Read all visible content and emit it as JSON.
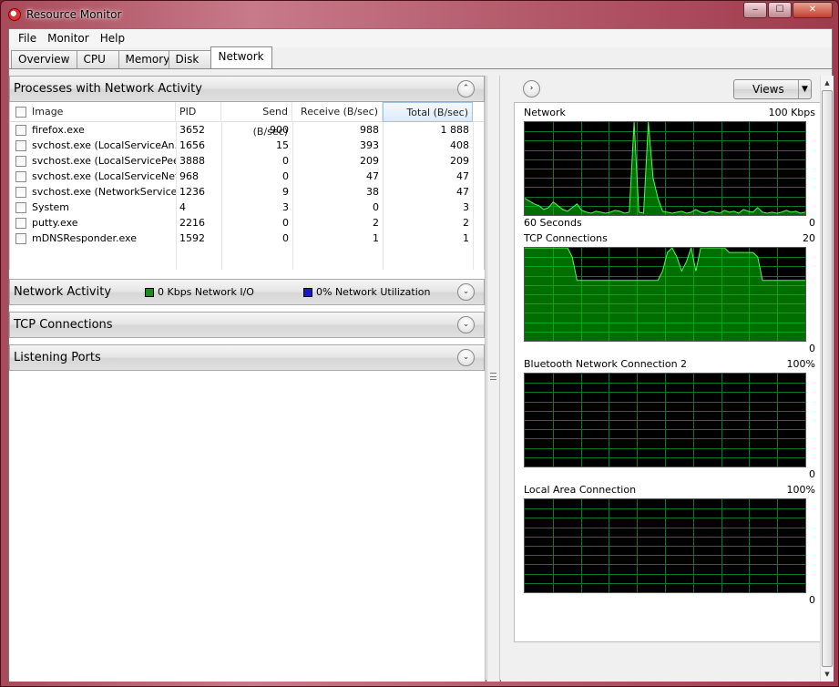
{
  "window": {
    "title": "Resource Monitor",
    "buttons": {
      "minimize": "‒",
      "maximize": "☐",
      "close": "✕"
    }
  },
  "menu": [
    "File",
    "Monitor",
    "Help"
  ],
  "tabs": [
    {
      "label": "Overview",
      "active": false
    },
    {
      "label": "CPU",
      "active": false
    },
    {
      "label": "Memory",
      "active": false
    },
    {
      "label": "Disk",
      "active": false
    },
    {
      "label": "Network",
      "active": true
    }
  ],
  "processes": {
    "title": "Processes with Network Activity",
    "columns": [
      "Image",
      "PID",
      "Send (B/sec)",
      "Receive (B/sec)",
      "Total (B/sec)"
    ],
    "rows": [
      {
        "image": "firefox.exe",
        "pid": "3652",
        "send": "900",
        "receive": "988",
        "total": "1 888"
      },
      {
        "image": "svchost.exe (LocalServiceAn...",
        "pid": "1656",
        "send": "15",
        "receive": "393",
        "total": "408"
      },
      {
        "image": "svchost.exe (LocalServicePee...",
        "pid": "3888",
        "send": "0",
        "receive": "209",
        "total": "209"
      },
      {
        "image": "svchost.exe (LocalServiceNet...",
        "pid": "968",
        "send": "0",
        "receive": "47",
        "total": "47"
      },
      {
        "image": "svchost.exe (NetworkService)",
        "pid": "1236",
        "send": "9",
        "receive": "38",
        "total": "47"
      },
      {
        "image": "System",
        "pid": "4",
        "send": "3",
        "receive": "0",
        "total": "3"
      },
      {
        "image": "putty.exe",
        "pid": "2216",
        "send": "0",
        "receive": "2",
        "total": "2"
      },
      {
        "image": "mDNSResponder.exe",
        "pid": "1592",
        "send": "0",
        "receive": "1",
        "total": "1"
      }
    ]
  },
  "network_activity": {
    "title": "Network Activity",
    "io_label": "0 Kbps Network I/O",
    "util_label": "0% Network Utilization",
    "io_color": "#1e8a1e",
    "util_color": "#1a1ab8"
  },
  "tcp_section": {
    "title": "TCP Connections"
  },
  "listening_section": {
    "title": "Listening Ports"
  },
  "views_button": "Views",
  "graphs": [
    {
      "title": "Network",
      "max": "100 Kbps",
      "min": "0",
      "footer": "60 Seconds",
      "chart_data": {
        "type": "area",
        "ylim": [
          0,
          100
        ],
        "values": [
          18,
          15,
          12,
          10,
          6,
          8,
          14,
          10,
          6,
          4,
          8,
          12,
          5,
          3,
          2,
          4,
          3,
          2,
          3,
          5,
          4,
          2,
          3,
          100,
          3,
          2,
          100,
          40,
          18,
          4,
          3,
          2,
          3,
          4,
          2,
          3,
          6,
          3,
          2,
          4,
          3,
          2,
          5,
          3,
          4,
          2,
          6,
          4,
          3,
          8,
          3,
          2,
          3,
          2,
          3,
          5,
          3,
          4,
          2,
          3
        ]
      }
    },
    {
      "title": "TCP Connections",
      "max": "20",
      "min": "0",
      "chart_data": {
        "type": "area",
        "ylim": [
          0,
          20
        ],
        "values": [
          20,
          20,
          20,
          20,
          20,
          20,
          20,
          20,
          20,
          20,
          18,
          13,
          13,
          13,
          13,
          13,
          13,
          13,
          13,
          13,
          13,
          13,
          13,
          13,
          13,
          13,
          13,
          13,
          13,
          15,
          19,
          20,
          18,
          15,
          17,
          20,
          15,
          20,
          20,
          20,
          20,
          20,
          20,
          19,
          19,
          19,
          19,
          19,
          19,
          18,
          13,
          13,
          13,
          13,
          13,
          13,
          13,
          13,
          13,
          13
        ]
      }
    },
    {
      "title": "Bluetooth Network Connection 2",
      "max": "100%",
      "min": "0",
      "chart_data": {
        "type": "area",
        "ylim": [
          0,
          100
        ],
        "values": []
      }
    },
    {
      "title": "Local Area Connection",
      "max": "100%",
      "min": "0",
      "chart_data": {
        "type": "area",
        "ylim": [
          0,
          100
        ],
        "values": []
      }
    }
  ]
}
